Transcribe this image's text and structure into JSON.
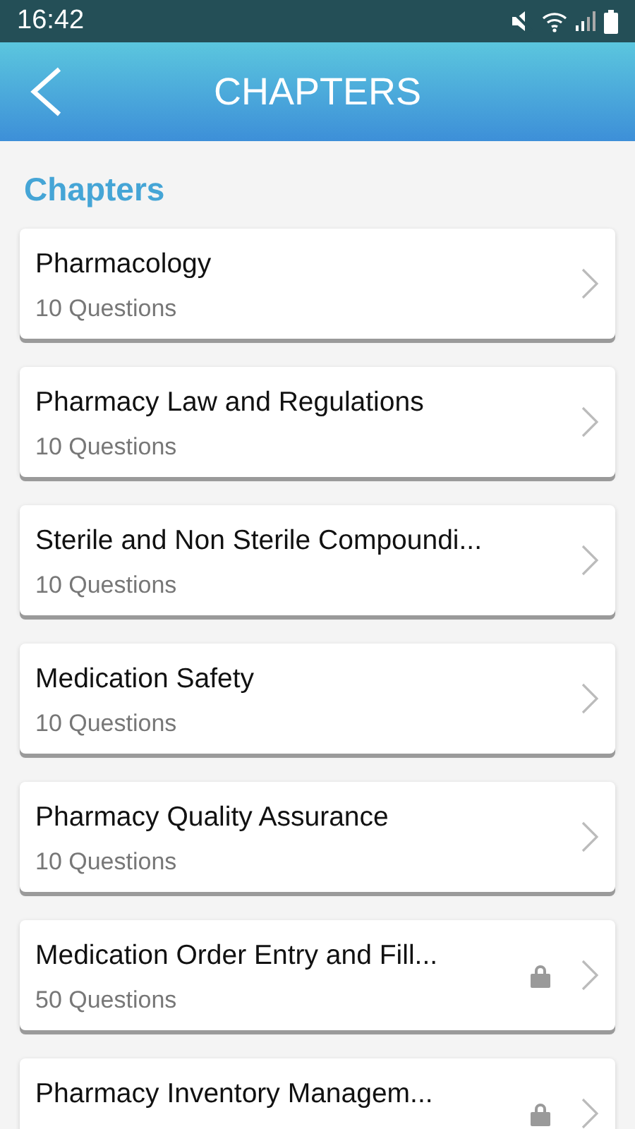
{
  "status_bar": {
    "time": "16:42"
  },
  "header": {
    "title": "CHAPTERS"
  },
  "section_title": "Chapters",
  "chapters": [
    {
      "title": "Pharmacology",
      "questions": "10 Questions",
      "locked": false
    },
    {
      "title": "Pharmacy Law and Regulations",
      "questions": "10 Questions",
      "locked": false
    },
    {
      "title": "Sterile and Non Sterile Compoundi...",
      "questions": "10 Questions",
      "locked": false
    },
    {
      "title": "Medication Safety",
      "questions": "10 Questions",
      "locked": false
    },
    {
      "title": "Pharmacy Quality Assurance",
      "questions": "10 Questions",
      "locked": false
    },
    {
      "title": "Medication Order Entry and Fill...",
      "questions": "50 Questions",
      "locked": true
    },
    {
      "title": "Pharmacy Inventory Managem...",
      "locked": true
    }
  ]
}
